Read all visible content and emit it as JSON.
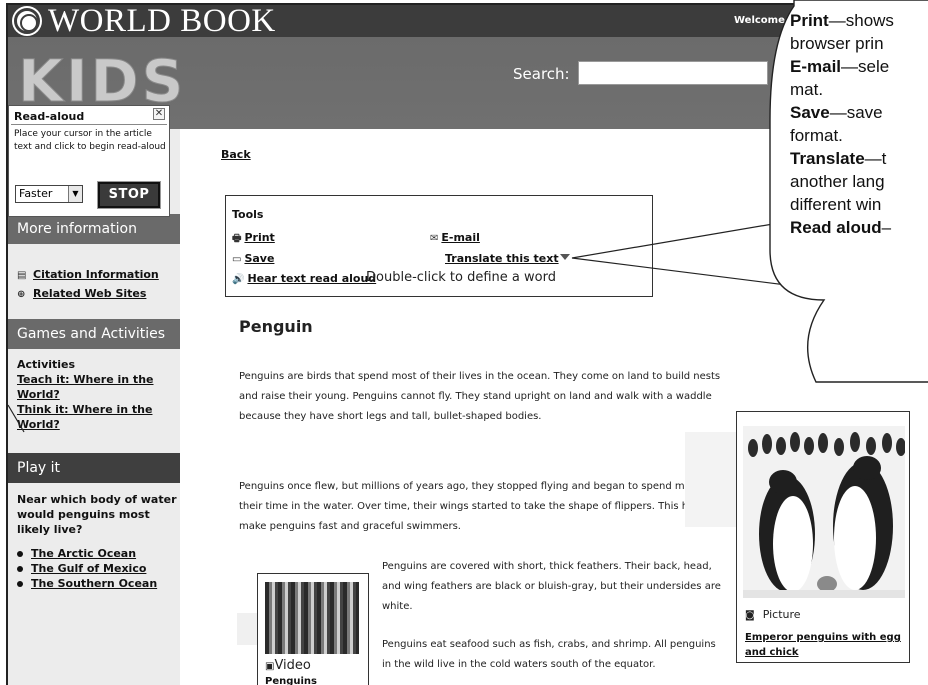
{
  "header": {
    "brand": "WORLD BOOK",
    "kids_logo": "KIDS",
    "welcome": "Welcome",
    "search_label": "Search:",
    "search_value": ""
  },
  "readaloud": {
    "title": "Read-aloud",
    "close": "✕",
    "instructions": "Place your cursor in the article text and click to begin read-aloud",
    "speed": "Faster",
    "stop": "STOP"
  },
  "sidebar": {
    "more_info_heading": "More information",
    "more_info_links": [
      "Citation Information",
      "Related Web Sites"
    ],
    "games_heading": "Games and Activities",
    "activities_label": "Activities",
    "activity_links": [
      "Teach it: Where in the World?",
      "Think it: Where in the World?"
    ],
    "play_heading": "Play it",
    "question": "Near which body of water would penguins most likely live?",
    "answers": [
      "The Arctic Ocean",
      "The Gulf of Mexico",
      "The Southern Ocean"
    ]
  },
  "main": {
    "back": "Back",
    "tools": {
      "title": "Tools",
      "print": "Print",
      "email": "E-mail",
      "save": "Save",
      "translate": "Translate this text",
      "hear": "Hear text read aloud",
      "hint": "Double-click to define a word"
    },
    "article_title": "Penguin",
    "paragraphs": [
      "Penguins are birds that spend most of their lives in the ocean. They come on land to build nests and raise their young. Penguins cannot fly. They stand upright on land and walk with a waddle because they have short legs and tall, bullet-shaped bodies.",
      "Penguins once flew, but millions of years ago, they stopped flying and began to spend most of their time in the water. Over time, their wings started to take the shape of flippers. This helped make penguins fast and graceful swimmers.",
      "Penguins are covered with short, thick feathers. Their back, head, and wing feathers are black or bluish-gray, but their undersides are white.",
      "Penguins eat seafood such as fish, crabs, and shrimp. All penguins in the wild live in the cold waters south of the equator."
    ],
    "video": {
      "label": "Video",
      "link": "Penguins"
    },
    "picture": {
      "label": "Picture",
      "caption": "Emperor penguins with egg and chick"
    }
  },
  "callout": {
    "lines": [
      {
        "bold": "Print",
        "rest": "—shows"
      },
      {
        "bold": "",
        "rest": "browser prin"
      },
      {
        "bold": "E-mail",
        "rest": "—sele"
      },
      {
        "bold": "",
        "rest": "mat."
      },
      {
        "bold": "Save",
        "rest": "—save"
      },
      {
        "bold": "",
        "rest": "format."
      },
      {
        "bold": "Translate",
        "rest": "—t"
      },
      {
        "bold": "",
        "rest": "another lang"
      },
      {
        "bold": "",
        "rest": "different win"
      },
      {
        "bold": "Read aloud",
        "rest": "–"
      }
    ]
  },
  "icons": [
    "globe-icon",
    "print-icon",
    "email-icon",
    "save-icon",
    "speaker-icon",
    "citation-icon",
    "web-icon",
    "video-icon",
    "camera-icon",
    "dropdown-arrow-icon",
    "close-icon"
  ]
}
